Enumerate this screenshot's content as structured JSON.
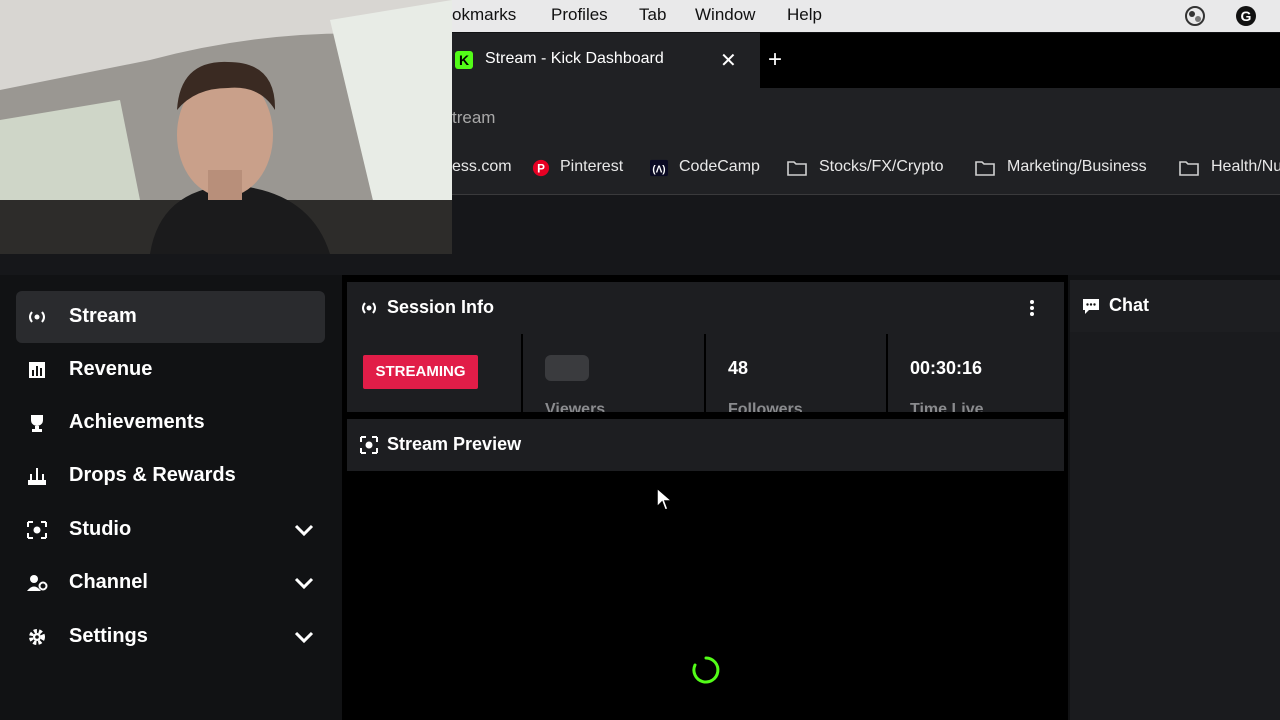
{
  "menubar": {
    "items": [
      "okmarks",
      "Profiles",
      "Tab",
      "Window",
      "Help"
    ]
  },
  "browser": {
    "tab_title": "Stream - Kick Dashboard",
    "favicon_letter": "K",
    "close_glyph": "✕",
    "newtab_glyph": "+",
    "url_text": "tream",
    "bookmarks": [
      {
        "label": "ess.com",
        "icon": "none"
      },
      {
        "label": "Pinterest",
        "icon": "pinterest-icon"
      },
      {
        "label": "CodeCamp",
        "icon": "freecodecamp-icon"
      },
      {
        "label": "Stocks/FX/Crypto",
        "icon": "folder-icon"
      },
      {
        "label": "Marketing/Business",
        "icon": "folder-icon"
      },
      {
        "label": "Health/Nu",
        "icon": "folder-icon"
      }
    ]
  },
  "sidebar": {
    "items": [
      {
        "label": "Stream",
        "icon": "stream-icon",
        "active": true
      },
      {
        "label": "Revenue",
        "icon": "revenue-icon"
      },
      {
        "label": "Achievements",
        "icon": "trophy-icon"
      },
      {
        "label": "Drops & Rewards",
        "icon": "drops-icon"
      },
      {
        "label": "Studio",
        "icon": "studio-icon",
        "expandable": true
      },
      {
        "label": "Channel",
        "icon": "channel-icon",
        "expandable": true
      },
      {
        "label": "Settings",
        "icon": "gear-icon",
        "expandable": true
      }
    ]
  },
  "session": {
    "title": "Session Info",
    "status": "STREAMING",
    "viewers_label": "Viewers",
    "followers_value": "48",
    "followers_label": "Followers",
    "time_value": "00:30:16",
    "time_label": "Time Live"
  },
  "preview": {
    "title": "Stream Preview"
  },
  "chat": {
    "title": "Chat"
  },
  "colors": {
    "accent": "#53fc18",
    "live": "#e11d48",
    "panel": "#1d1e21"
  }
}
